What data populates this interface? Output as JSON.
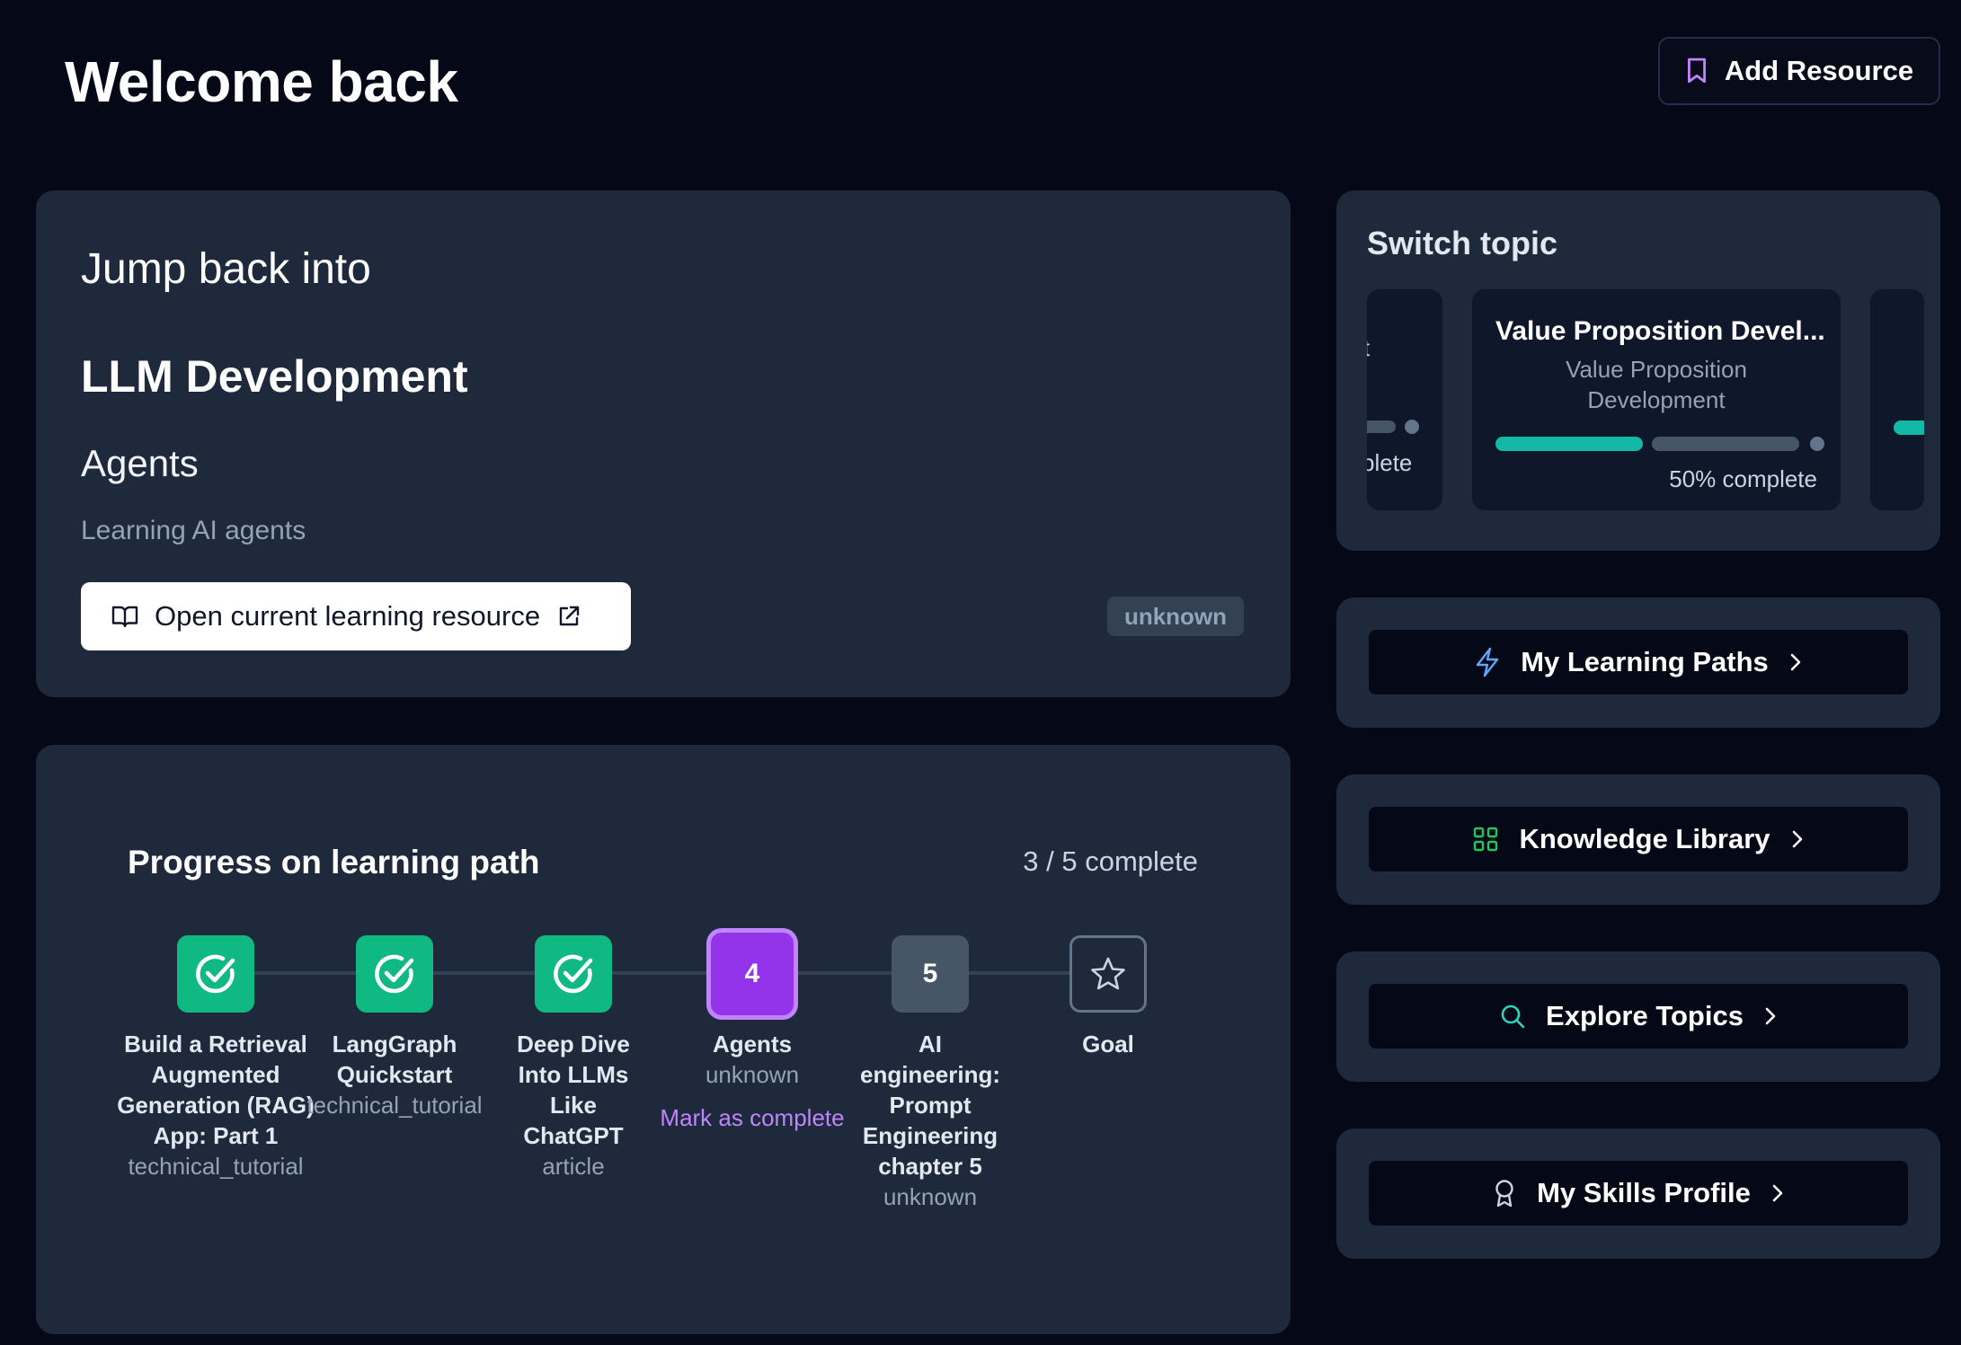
{
  "header": {
    "title": "Welcome back",
    "add_resource_label": "Add Resource"
  },
  "jump_back": {
    "heading": "Jump back into",
    "topic": "LLM Development",
    "sub_topic": "Agents",
    "description": "Learning AI agents",
    "open_button_label": "Open current learning resource",
    "status_badge": "unknown"
  },
  "progress": {
    "title": "Progress on learning path",
    "count": "3 / 5 complete",
    "steps": [
      {
        "number": "1",
        "title": "Build a Retrieval Augmented Generation (RAG) App: Part 1",
        "type": "technical_tutorial",
        "state": "done"
      },
      {
        "number": "2",
        "title": "LangGraph Quickstart",
        "type": "technical_tutorial",
        "state": "done"
      },
      {
        "number": "3",
        "title": "Deep Dive Into LLMs Like ChatGPT",
        "type": "article",
        "state": "done"
      },
      {
        "number": "4",
        "title": "Agents",
        "type": "unknown",
        "state": "current",
        "action": "Mark as complete"
      },
      {
        "number": "5",
        "title": "AI engineering: Prompt Engineering chapter 5",
        "type": "unknown",
        "state": "pending"
      },
      {
        "number": "",
        "title": "Goal",
        "type": "",
        "state": "goal"
      }
    ]
  },
  "switch_topic": {
    "title": "Switch topic",
    "left_fragment_text": "t",
    "left_fragment_pct": "plete",
    "main_topic": {
      "name": "Value Proposition Devel...",
      "subtitle": "Value Proposition Development",
      "progress": 0.5,
      "progress_label": "50% complete"
    }
  },
  "nav": {
    "learning_paths": "My Learning Paths",
    "knowledge_library": "Knowledge Library",
    "explore_topics": "Explore Topics",
    "skills_profile": "My Skills Profile"
  },
  "colors": {
    "background": "#050816",
    "card": "#1e293b",
    "done": "#10b981",
    "current": "#9333ea",
    "accent_teal": "#14b8a6",
    "accent_purple": "#c084fc",
    "icon_blue": "#60a5fa",
    "icon_green": "#22c55e",
    "icon_teal": "#2dd4bf"
  }
}
